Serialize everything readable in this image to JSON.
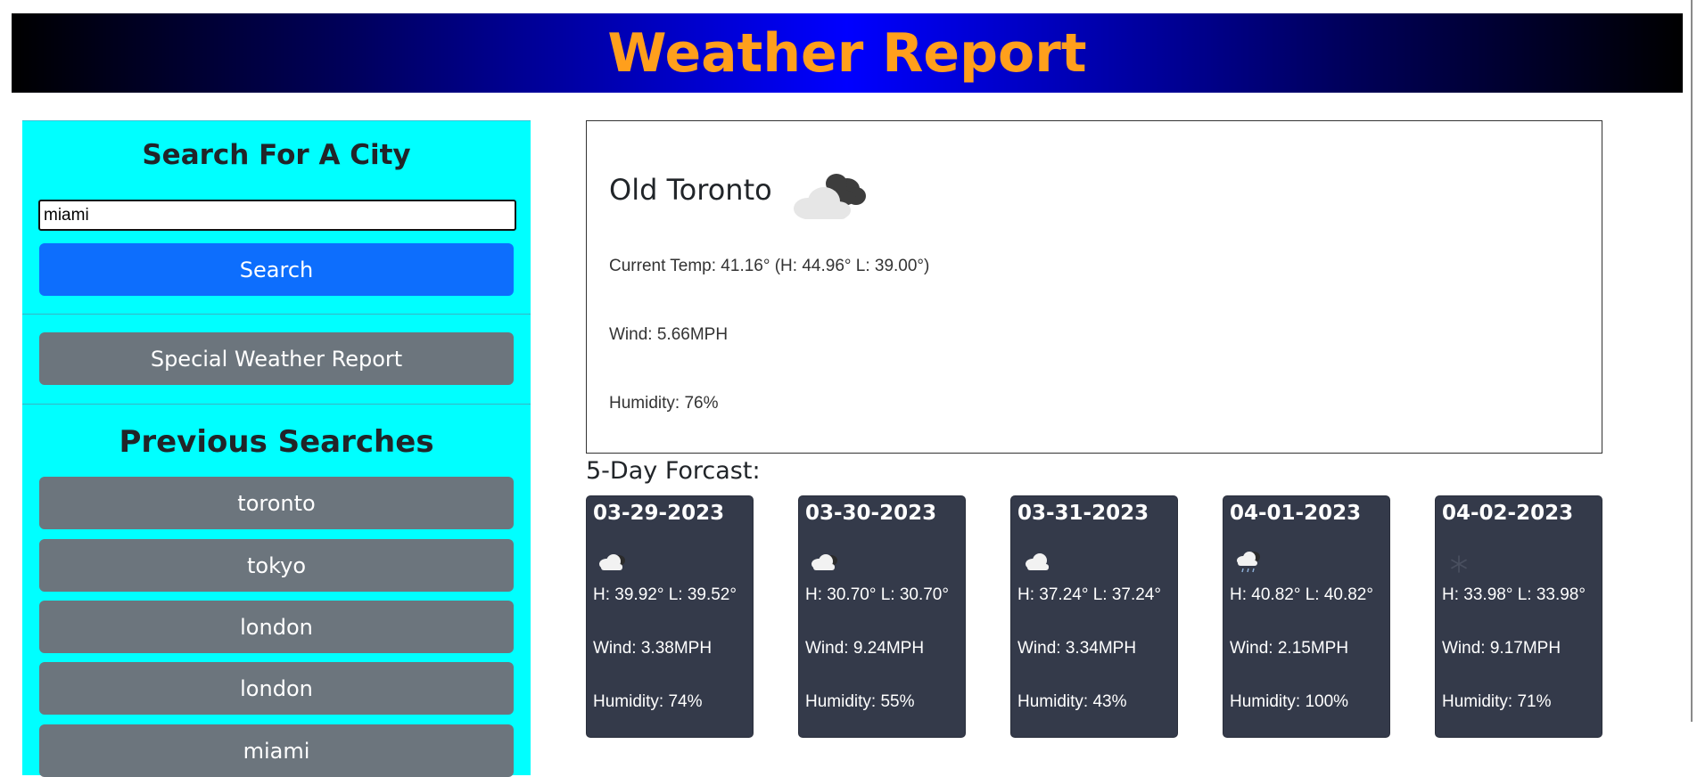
{
  "header": {
    "title": "Weather Report"
  },
  "sidebar": {
    "search_title": "Search For A City",
    "search_input_value": "miami",
    "search_button_label": "Search",
    "special_button_label": "Special Weather Report",
    "previous_title": "Previous Searches",
    "previous_searches": [
      {
        "label": "toronto"
      },
      {
        "label": "tokyo"
      },
      {
        "label": "london"
      },
      {
        "label": "london"
      },
      {
        "label": "miami"
      }
    ]
  },
  "current": {
    "city": "Old Toronto",
    "icon": "broken-clouds-icon",
    "temp_line": "Current Temp: 41.16° (H: 44.96° L: 39.00°)",
    "wind_line": "Wind: 5.66MPH",
    "humidity_line": "Humidity: 76%"
  },
  "forecast": {
    "label": "5-Day Forcast:",
    "days": [
      {
        "date": "03-29-2023",
        "icon": "broken-clouds-icon",
        "hl": "H: 39.92° L: 39.52°",
        "wind": "Wind: 3.38MPH",
        "humidity": "Humidity: 74%"
      },
      {
        "date": "03-30-2023",
        "icon": "broken-clouds-icon",
        "hl": "H: 30.70° L: 30.70°",
        "wind": "Wind: 9.24MPH",
        "humidity": "Humidity: 55%"
      },
      {
        "date": "03-31-2023",
        "icon": "cloud-icon",
        "hl": "H: 37.24° L: 37.24°",
        "wind": "Wind: 3.34MPH",
        "humidity": "Humidity: 43%"
      },
      {
        "date": "04-01-2023",
        "icon": "rain-cloud-icon",
        "hl": "H: 40.82° L: 40.82°",
        "wind": "Wind: 2.15MPH",
        "humidity": "Humidity: 100%"
      },
      {
        "date": "04-02-2023",
        "icon": "snowflake-icon",
        "hl": "H: 33.98° L: 33.98°",
        "wind": "Wind: 9.17MPH",
        "humidity": "Humidity: 71%"
      }
    ]
  },
  "colors": {
    "header_title": "#ff9f1c",
    "sidebar_bg": "#00ffff",
    "primary_button": "#0d6efd",
    "gray_button": "#6c757d",
    "forecast_card": "#343a4a"
  }
}
